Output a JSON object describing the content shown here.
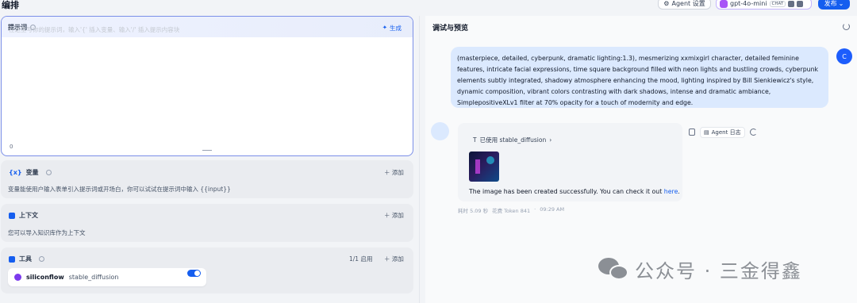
{
  "header": {
    "title": "编排",
    "agent_settings": "Agent 设置",
    "model": {
      "name": "gpt-4o-mini",
      "tag": "CHAT"
    },
    "publish": "发布"
  },
  "prompt": {
    "label": "提示词",
    "generate": "生成",
    "placeholder": "在这里写你的提示词，输入'{' 插入变量、输入'/' 插入提示内容块",
    "count": "0"
  },
  "variables": {
    "title": "变量",
    "add": "添加",
    "desc": "变量能使用户输入表单引入提示词或开场白，你可以试试在提示词中输入 {{input}}"
  },
  "context": {
    "title": "上下文",
    "add": "添加",
    "desc": "您可以导入知识库作为上下文"
  },
  "tools": {
    "title": "工具",
    "enabled_count": "1/1 启用",
    "add": "添加",
    "item": {
      "provider": "siliconflow",
      "name": "stable_diffusion"
    }
  },
  "debug": {
    "title": "调试与预览",
    "user_avatar": "C",
    "user_message": "(masterpiece, detailed, cyberpunk, dramatic lighting:1.3), mesmerizing xxmixgirl character, detailed feminine features, intricate facial expressions, time square background filled with neon lights and bustling crowds, cyberpunk elements subtly integrated, shadowy atmosphere enhancing the mood, lighting inspired by Bill Sienkiewicz's style, dynamic composition, vibrant colors contrasting with dark shadows, intense and dramatic ambiance, SimplepositiveXLv1 filter at 70% opacity for a touch of modernity and edge.",
    "used_tool": "已使用 stable_diffusion",
    "result_text": "The image has been created successfully. You can check it out",
    "result_link": "here",
    "result_end": ".",
    "meta_time": "耗时 5.09 秒",
    "meta_tokens": "花费 Token 841",
    "meta_clock": "09:29 AM",
    "agent_log": "Agent 日志"
  },
  "watermark": "公众号 · 三金得鑫"
}
